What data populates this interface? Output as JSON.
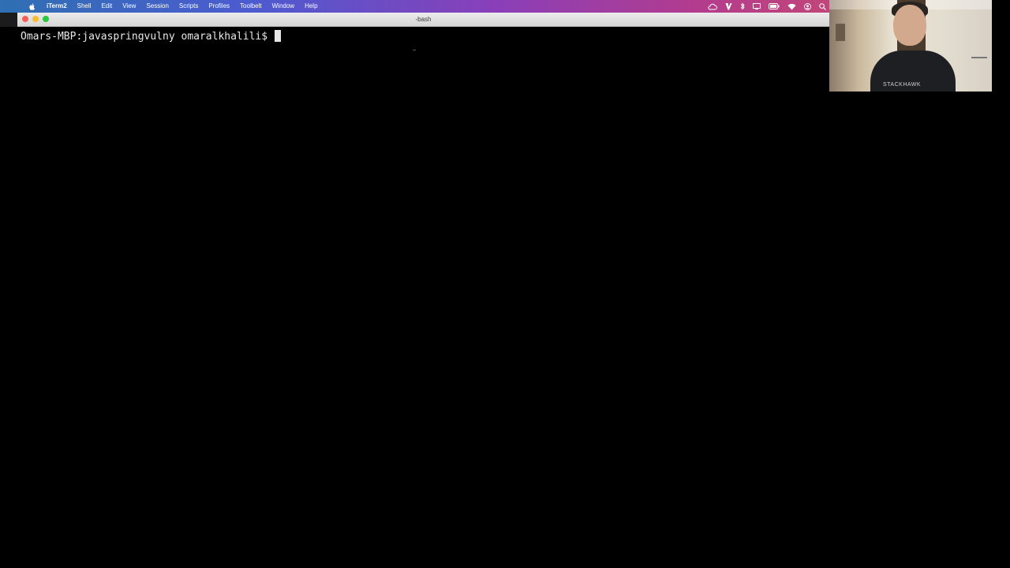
{
  "menubar": {
    "apple_icon": "apple-icon",
    "app_name": "iTerm2",
    "items": [
      "Shell",
      "Edit",
      "View",
      "Session",
      "Scripts",
      "Profiles",
      "Toolbelt",
      "Window",
      "Help"
    ],
    "status_icons": [
      "creative-cloud-icon",
      "vim-icon",
      "bluetooth-icon",
      "display-icon",
      "battery-icon",
      "wifi-icon",
      "user-icon",
      "search-icon"
    ]
  },
  "window": {
    "title": "-bash"
  },
  "terminal": {
    "prompt": "Omars-MBP:javaspringvulny omaralkhalili$"
  },
  "webcam": {
    "shirt_logo": "STACKHAWK"
  },
  "colors": {
    "terminal_bg": "#000000",
    "terminal_fg": "#e8e8e8",
    "close": "#fc5f57",
    "minimize": "#fdbc2e",
    "maximize": "#28c840"
  }
}
